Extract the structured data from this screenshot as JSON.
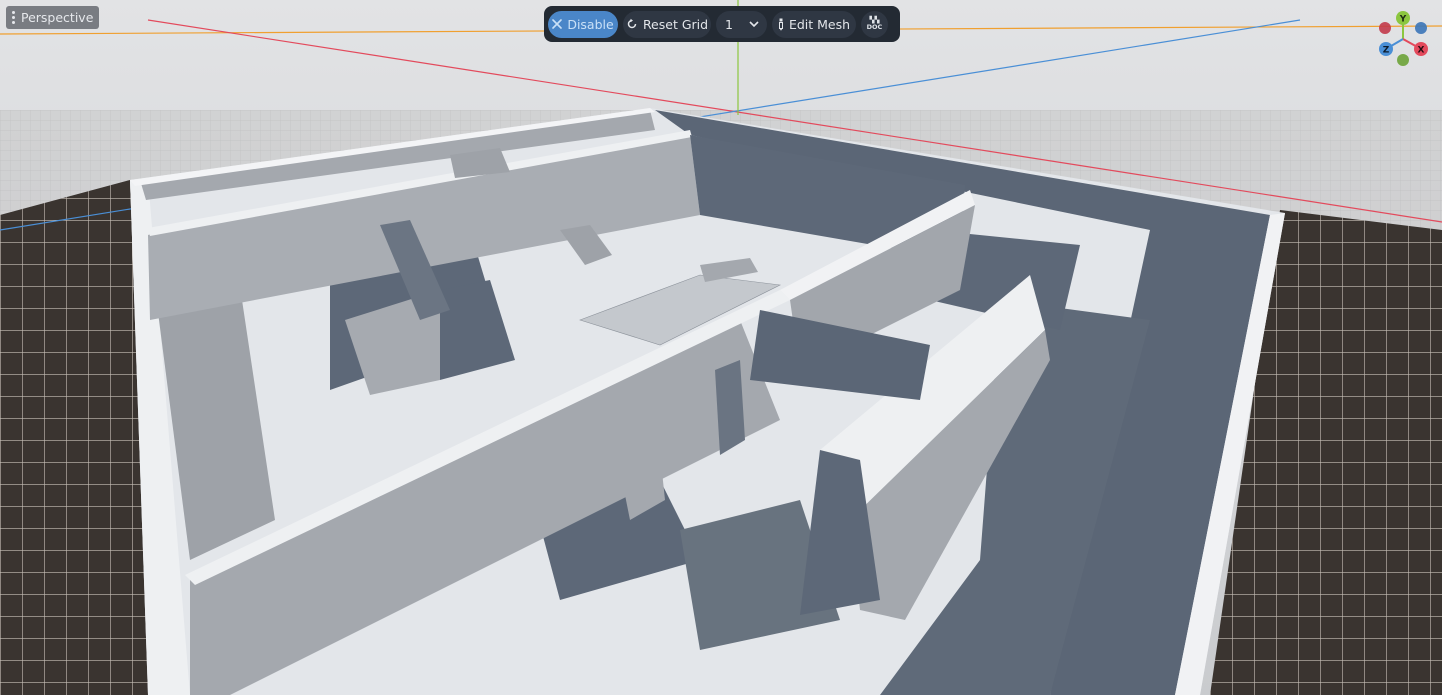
{
  "viewport": {
    "view_mode_label": "Perspective"
  },
  "toolbar": {
    "disable_label": "Disable",
    "reset_grid_label": "Reset Grid",
    "grid_size_value": "1",
    "edit_mesh_label": "Edit Mesh",
    "doc_label_top": "▚▚",
    "doc_label_bottom": "DOC"
  },
  "gizmo": {
    "y_label": "Y",
    "x_label": "X",
    "z_label": "Z"
  },
  "colors": {
    "x_axis": "#e34a5c",
    "y_axis": "#8cc63f",
    "z_axis": "#4a8fd6",
    "accent": "#4a86c8",
    "toolbar_bg": "#232a33"
  }
}
